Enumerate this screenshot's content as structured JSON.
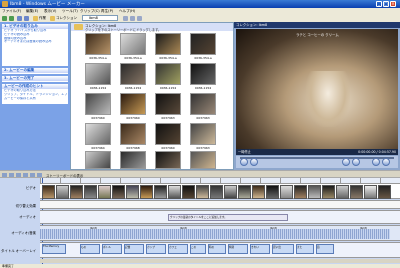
{
  "window": {
    "title": "Ibm8 - Windows ムービー メーカー"
  },
  "menu": [
    "ファイル(F)",
    "編集(E)",
    "表示(V)",
    "ツール(T)",
    "クリップ(C)",
    "再生(P)",
    "ヘルプ(H)"
  ],
  "toolbar": {
    "tasks_label": "作業",
    "collections_label": "コレクション",
    "collection_select": "Ibm8"
  },
  "tasks": [
    {
      "title": "ムービーの作成",
      "items": [
        {
          "title": "1. ビデオの取り込み",
          "items": [
            "ビデオ デバイスから取り込み",
            "ビデオの読み込み",
            "画像の読み込み",
            "オーディオまたは音楽の読み込み"
          ]
        },
        {
          "title": "2. ムービーの編集",
          "items": []
        },
        {
          "title": "3. ムービーの完了",
          "items": []
        },
        {
          "title": "ムービーの作成のヒント",
          "items": [
            "ビデオの取り込み方法",
            "クリップ、タイトル、トランジション、エフェクトの使用法",
            "ムービーの保存と共有"
          ]
        }
      ]
    }
  ],
  "collection": {
    "header_title": "コレクション: Ibm8",
    "header_hint": "クリップを下のストーリーボードにドラッグします。",
    "clips": [
      "0036-354-a",
      "0036-354-a",
      "0036-354-a",
      "0036-354-a",
      "0036-1154",
      "0036-1154",
      "0036-1154",
      "0036-1154",
      "0037960",
      "0037960",
      "0037963",
      "0037963",
      "0037964",
      "0037968",
      "0037960",
      "0037963"
    ]
  },
  "preview": {
    "title": "コレクション: Ibm8",
    "monitor_caption": "ラテと コーヒーの クリーム",
    "status_left": "一時停止",
    "time": "0:00:00.00 / 0:04:57.90"
  },
  "timeline_bar": {
    "label": "ストーリーボードの表示"
  },
  "timeline": {
    "tracks": [
      "ビデオ",
      "切り替え効果",
      "オーディオ",
      "オーディオ/音楽",
      "タイトル オーバーレイ"
    ],
    "title_overlay_text": "クリップの最初のタイトルをここに追加します。",
    "music_label": "Ibm8",
    "title_clips": [
      "The Memory",
      "もの",
      "ボトル",
      "記憶",
      "カップ",
      "カフェ",
      "この",
      "時の",
      "特別",
      "きれい",
      "思い出",
      "また",
      "街"
    ]
  },
  "status": "準備完了"
}
